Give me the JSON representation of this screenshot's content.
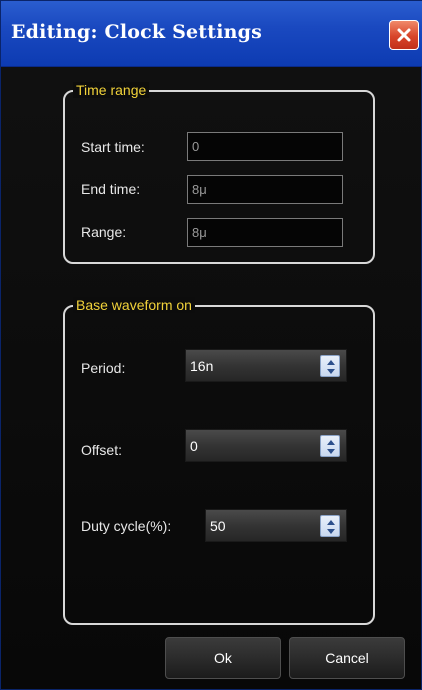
{
  "window": {
    "title": "Editing: Clock Settings",
    "close_icon": "close-icon"
  },
  "time_range": {
    "legend": "Time range",
    "start_time": {
      "label": "Start time:",
      "value": "0"
    },
    "end_time": {
      "label": "End time:",
      "value": "8μ"
    },
    "range": {
      "label": "Range:",
      "value": "8μ"
    }
  },
  "base_waveform": {
    "legend": "Base waveform on",
    "period": {
      "label": "Period:",
      "value": "16n"
    },
    "offset": {
      "label": "Offset:",
      "value": "0"
    },
    "duty_cycle": {
      "label": "Duty cycle(%):",
      "value": "50"
    }
  },
  "buttons": {
    "ok": "Ok",
    "cancel": "Cancel"
  },
  "colors": {
    "legend": "#f2d33a",
    "titlebar": "#1a49c0",
    "close": "#d8452a"
  }
}
